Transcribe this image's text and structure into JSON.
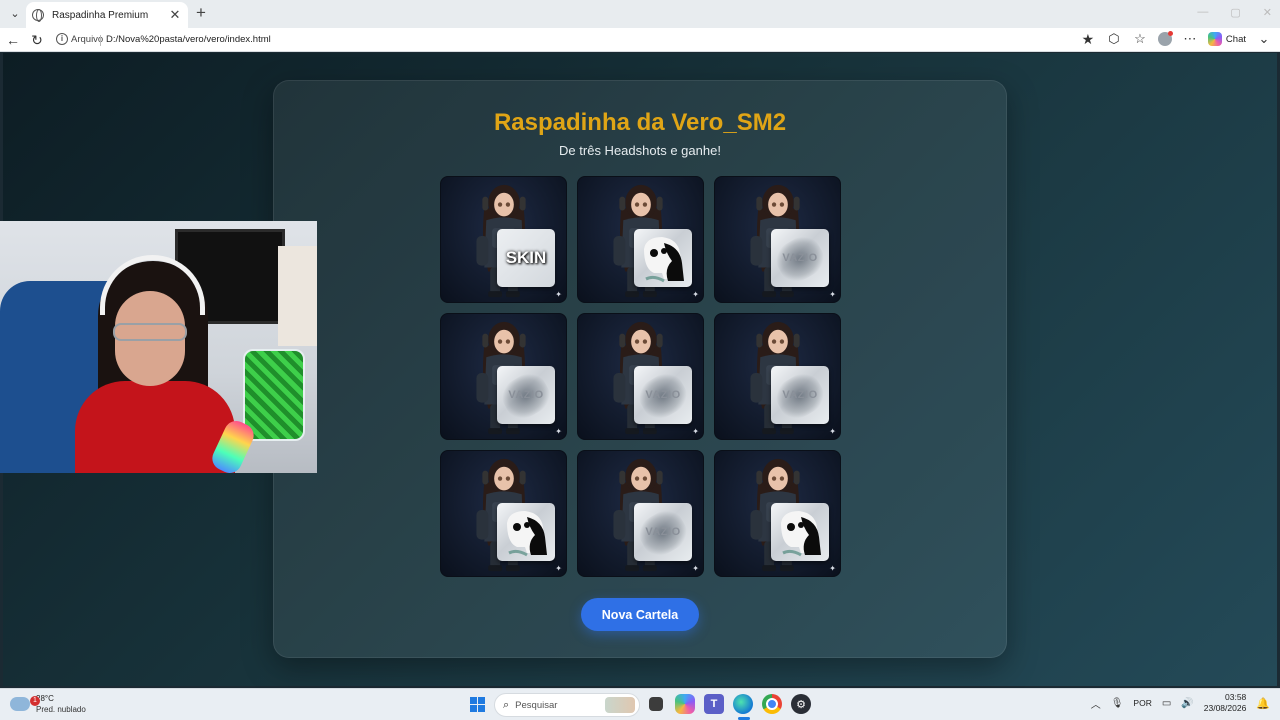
{
  "browser": {
    "tab_title": "Raspadinha Premium",
    "tab_close": "✕",
    "new_tab": "+",
    "url_scheme": "Arquivo",
    "url": "D:/Nova%20pasta/vero/vero/index.html",
    "chat_label": "Chat"
  },
  "game": {
    "title": "Raspadinha da Vero_SM2",
    "subtitle": "De três Headshots e ganhe!",
    "cells": [
      {
        "result": "skin",
        "label": "SKIN"
      },
      {
        "result": "headshot",
        "label": ""
      },
      {
        "result": "vazio",
        "label": "VAZIO"
      },
      {
        "result": "vazio",
        "label": "VAZIO"
      },
      {
        "result": "vazio",
        "label": "VAZIO"
      },
      {
        "result": "vazio",
        "label": "VAZIO"
      },
      {
        "result": "headshot",
        "label": ""
      },
      {
        "result": "vazio",
        "label": "VAZIO"
      },
      {
        "result": "headshot",
        "label": ""
      }
    ],
    "new_card_button": "Nova Cartela",
    "accent_color": "#e0a516",
    "button_color": "#2f70e6"
  },
  "taskbar": {
    "weather_alert": "1",
    "weather_temp": "28°C",
    "weather_condition": "Pred. nublado",
    "search_placeholder": "Pesquisar",
    "language": "POR",
    "time": "03:58",
    "date": "23/08/2026"
  }
}
